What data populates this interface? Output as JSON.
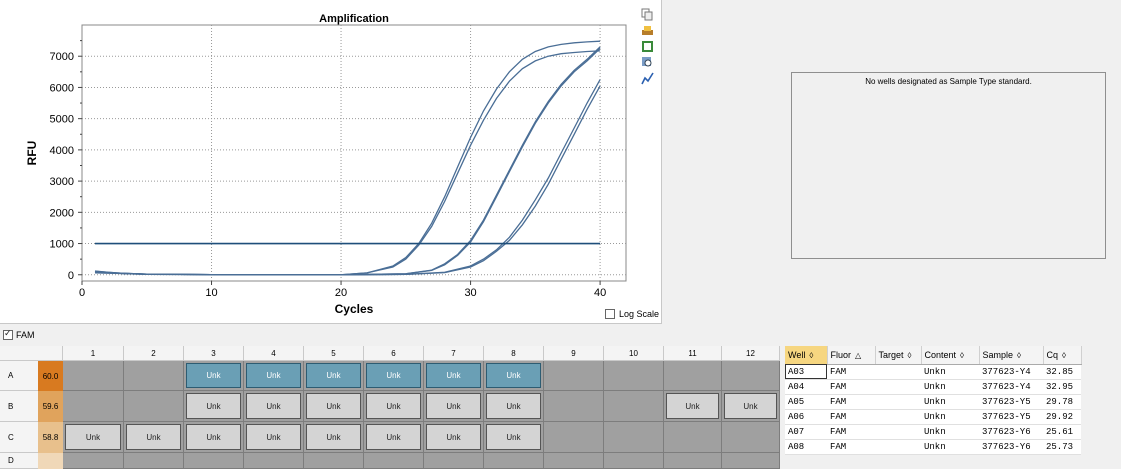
{
  "chart_data": {
    "type": "line",
    "title": "Amplification",
    "xlabel": "Cycles",
    "ylabel": "RFU",
    "xlim": [
      0,
      42
    ],
    "ylim": [
      -200,
      8000
    ],
    "xticks": [
      0,
      10,
      20,
      30,
      40
    ],
    "yticks": [
      0,
      1000,
      2000,
      3000,
      4000,
      5000,
      6000,
      7000
    ],
    "grid": true,
    "threshold": 1000,
    "series": [
      {
        "x": [
          1,
          2,
          3,
          5,
          10,
          15,
          20,
          22,
          24,
          25,
          26,
          27,
          28,
          29,
          30,
          31,
          32,
          33,
          34,
          35,
          36,
          37,
          38,
          39,
          40
        ],
        "values": [
          120,
          80,
          50,
          20,
          5,
          0,
          0,
          60,
          280,
          550,
          1000,
          1650,
          2500,
          3450,
          4400,
          5250,
          5950,
          6500,
          6900,
          7150,
          7300,
          7380,
          7430,
          7460,
          7480
        ]
      },
      {
        "x": [
          1,
          2,
          3,
          5,
          10,
          15,
          20,
          22,
          24,
          25,
          26,
          27,
          28,
          29,
          30,
          31,
          32,
          33,
          34,
          35,
          36,
          37,
          38,
          39,
          40
        ],
        "values": [
          80,
          60,
          40,
          15,
          5,
          0,
          0,
          60,
          250,
          500,
          950,
          1550,
          2350,
          3250,
          4150,
          4950,
          5650,
          6200,
          6600,
          6850,
          7000,
          7080,
          7120,
          7150,
          7170
        ]
      },
      {
        "x": [
          1,
          2,
          3,
          5,
          10,
          15,
          20,
          25,
          27,
          28,
          29,
          30,
          31,
          32,
          33,
          34,
          35,
          36,
          37,
          38,
          39,
          40
        ],
        "values": [
          100,
          70,
          45,
          20,
          5,
          0,
          0,
          30,
          150,
          350,
          650,
          1100,
          1750,
          2550,
          3350,
          4150,
          4900,
          5550,
          6100,
          6550,
          6900,
          7300
        ]
      },
      {
        "x": [
          1,
          2,
          3,
          5,
          10,
          15,
          20,
          25,
          27,
          28,
          29,
          30,
          31,
          32,
          33,
          34,
          35,
          36,
          37,
          38,
          39,
          40
        ],
        "values": [
          60,
          50,
          40,
          15,
          5,
          0,
          0,
          30,
          140,
          320,
          620,
          1050,
          1700,
          2500,
          3300,
          4100,
          4850,
          5500,
          6050,
          6500,
          6850,
          7250
        ]
      },
      {
        "x": [
          1,
          2,
          3,
          5,
          10,
          15,
          20,
          25,
          28,
          30,
          31,
          32,
          33,
          34,
          35,
          36,
          37,
          38,
          39,
          40
        ],
        "values": [
          110,
          80,
          50,
          20,
          5,
          0,
          0,
          10,
          80,
          280,
          500,
          800,
          1200,
          1750,
          2400,
          3100,
          3900,
          4700,
          5500,
          6250
        ]
      },
      {
        "x": [
          1,
          2,
          3,
          5,
          10,
          15,
          20,
          25,
          28,
          30,
          31,
          32,
          33,
          34,
          35,
          36,
          37,
          38,
          39,
          40
        ],
        "values": [
          90,
          70,
          45,
          20,
          5,
          0,
          0,
          10,
          70,
          250,
          450,
          750,
          1100,
          1600,
          2200,
          2900,
          3700,
          4500,
          5300,
          6050
        ]
      }
    ]
  },
  "log_scale_label": "Log Scale",
  "fluor_checkbox_label": "FAM",
  "standard_message": "No wells designated as Sample Type standard.",
  "plate": {
    "columns": [
      "1",
      "2",
      "3",
      "4",
      "5",
      "6",
      "7",
      "8",
      "9",
      "10",
      "11",
      "12"
    ],
    "rows": [
      {
        "label": "A",
        "temp": "60.0",
        "temp_color": "#d87a20",
        "wells": [
          {
            "t": ""
          },
          {
            "t": ""
          },
          {
            "t": "Unk",
            "sel": true
          },
          {
            "t": "Unk",
            "sel": true
          },
          {
            "t": "Unk",
            "sel": true
          },
          {
            "t": "Unk",
            "sel": true
          },
          {
            "t": "Unk",
            "sel": true
          },
          {
            "t": "Unk",
            "sel": true
          },
          {
            "t": ""
          },
          {
            "t": ""
          },
          {
            "t": ""
          },
          {
            "t": ""
          }
        ]
      },
      {
        "label": "B",
        "temp": "59.6",
        "temp_color": "#e0a35c",
        "wells": [
          {
            "t": ""
          },
          {
            "t": ""
          },
          {
            "t": "Unk"
          },
          {
            "t": "Unk"
          },
          {
            "t": "Unk"
          },
          {
            "t": "Unk"
          },
          {
            "t": "Unk"
          },
          {
            "t": "Unk"
          },
          {
            "t": ""
          },
          {
            "t": ""
          },
          {
            "t": "Unk"
          },
          {
            "t": "Unk"
          }
        ]
      },
      {
        "label": "C",
        "temp": "58.8",
        "temp_color": "#e8c08c",
        "wells": [
          {
            "t": "Unk"
          },
          {
            "t": "Unk"
          },
          {
            "t": "Unk"
          },
          {
            "t": "Unk"
          },
          {
            "t": "Unk"
          },
          {
            "t": "Unk"
          },
          {
            "t": "Unk"
          },
          {
            "t": "Unk"
          },
          {
            "t": ""
          },
          {
            "t": ""
          },
          {
            "t": ""
          },
          {
            "t": ""
          }
        ]
      },
      {
        "label": "D",
        "temp": "",
        "temp_color": "#f0d8b8",
        "wells": [
          {
            "t": ""
          },
          {
            "t": ""
          },
          {
            "t": ""
          },
          {
            "t": ""
          },
          {
            "t": ""
          },
          {
            "t": ""
          },
          {
            "t": ""
          },
          {
            "t": ""
          },
          {
            "t": ""
          },
          {
            "t": ""
          },
          {
            "t": ""
          },
          {
            "t": ""
          }
        ]
      }
    ]
  },
  "results_table": {
    "headers": [
      "Well",
      "Fluor",
      "Target",
      "Content",
      "Sample",
      "Cq"
    ],
    "sort_marks": [
      "◊",
      "△",
      "◊",
      "◊",
      "◊",
      "◊"
    ],
    "rows": [
      [
        "A03",
        "FAM",
        "",
        "Unkn",
        "377623-Y4",
        "32.85"
      ],
      [
        "A04",
        "FAM",
        "",
        "Unkn",
        "377623-Y4",
        "32.95"
      ],
      [
        "A05",
        "FAM",
        "",
        "Unkn",
        "377623-Y5",
        "29.78"
      ],
      [
        "A06",
        "FAM",
        "",
        "Unkn",
        "377623-Y5",
        "29.92"
      ],
      [
        "A07",
        "FAM",
        "",
        "Unkn",
        "377623-Y6",
        "25.61"
      ],
      [
        "A08",
        "FAM",
        "",
        "Unkn",
        "377623-Y6",
        "25.73"
      ]
    ]
  },
  "colors": {
    "curve": "#4a6e96",
    "threshold": "#1f4f7a",
    "well_selected": "#6a9fb5",
    "sort_header": "#f6d680"
  }
}
